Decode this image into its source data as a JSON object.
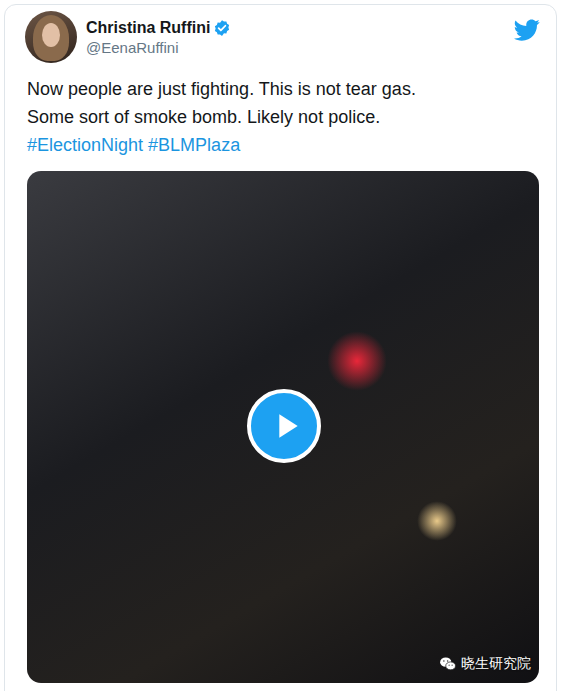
{
  "tweet_card": {
    "author": {
      "name": "Christina Ruffini",
      "handle": "@EenaRuffini",
      "verified": true
    },
    "lines": [
      [
        {
          "text": "Now people are just fighting. This is not tear gas.",
          "kind": "plain"
        }
      ],
      [
        {
          "text": "Some sort of smoke bomb. Likely not police.",
          "kind": "plain"
        }
      ],
      [
        {
          "text": "#ElectionNight",
          "kind": "hashtag"
        },
        {
          "text": " ",
          "kind": "plain"
        },
        {
          "text": "#BLMPlaza",
          "kind": "hashtag"
        }
      ]
    ],
    "media": {
      "kind": "video",
      "playing": false
    }
  },
  "watermark": {
    "text": "晓生研究院"
  }
}
